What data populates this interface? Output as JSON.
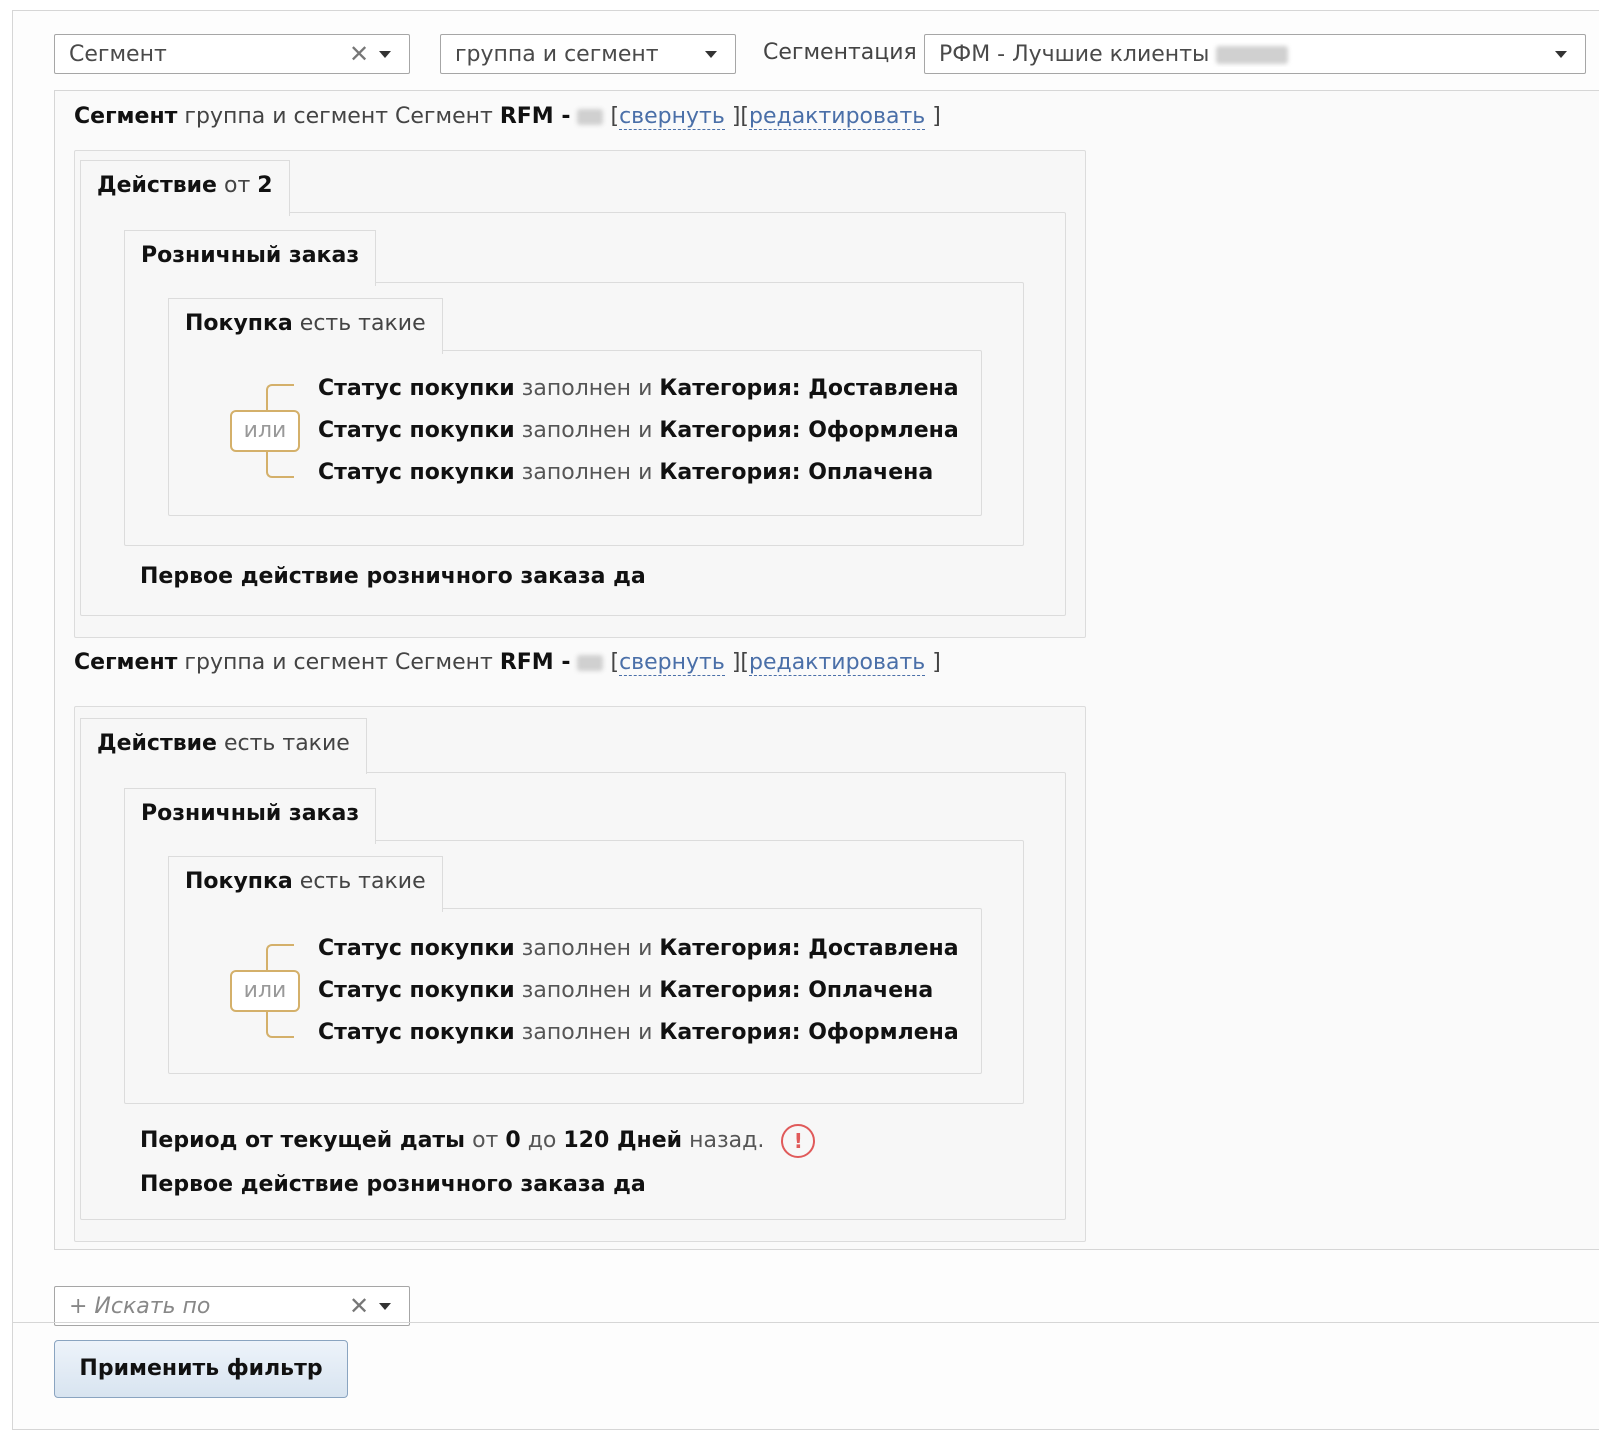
{
  "filter": {
    "field_select": {
      "value": "Сегмент"
    },
    "type_select": {
      "value": "группа и сегмент"
    },
    "segmentation_label": "Сегментация",
    "segmentation_select": {
      "value": "РФМ - Лучшие клиенты"
    },
    "search_select": {
      "placeholder": "+ Искать по"
    },
    "apply_label": "Применить фильтр"
  },
  "segments": [
    {
      "header": {
        "w1": "Сегмент",
        "w2": "группа и сегмент Сегмент",
        "w3": "RFM -",
        "open": "[",
        "collapse": "свернуть",
        "mid": "][",
        "edit": "редактировать",
        "close": "]"
      },
      "action_tab": {
        "bold": "Действие",
        "rest": "от",
        "num": "2"
      },
      "order_tab": "Розничный заказ",
      "purchase_tab": {
        "bold": "Покупка",
        "rest": "есть такие"
      },
      "ili": "или",
      "conditions": [
        {
          "a": "Статус покупки",
          "b": "заполнен",
          "c": "и",
          "d": "Категория: Доставлена"
        },
        {
          "a": "Статус покупки",
          "b": "заполнен",
          "c": "и",
          "d": "Категория: Оформлена"
        },
        {
          "a": "Статус покупки",
          "b": "заполнен",
          "c": "и",
          "d": "Категория: Оплачена"
        }
      ],
      "first_action": "Первое действие розничного заказа да"
    },
    {
      "header": {
        "w1": "Сегмент",
        "w2": "группа и сегмент Сегмент",
        "w3": "RFM -",
        "open": "[",
        "collapse": "свернуть",
        "mid": "][",
        "edit": "редактировать",
        "close": "]"
      },
      "action_tab": {
        "bold": "Действие",
        "rest": "есть такие"
      },
      "order_tab": "Розничный заказ",
      "purchase_tab": {
        "bold": "Покупка",
        "rest": "есть такие"
      },
      "ili": "или",
      "conditions": [
        {
          "a": "Статус покупки",
          "b": "заполнен",
          "c": "и",
          "d": "Категория: Доставлена"
        },
        {
          "a": "Статус покупки",
          "b": "заполнен",
          "c": "и",
          "d": "Категория: Оплачена"
        },
        {
          "a": "Статус покупки",
          "b": "заполнен",
          "c": "и",
          "d": "Категория: Оформлена"
        }
      ],
      "period": {
        "a": "Период от текущей даты",
        "b": "от",
        "c": "0",
        "d": "до",
        "e": "120 Дней",
        "f": "назад.",
        "warn": "!"
      },
      "first_action": "Первое действие розничного заказа да"
    }
  ]
}
